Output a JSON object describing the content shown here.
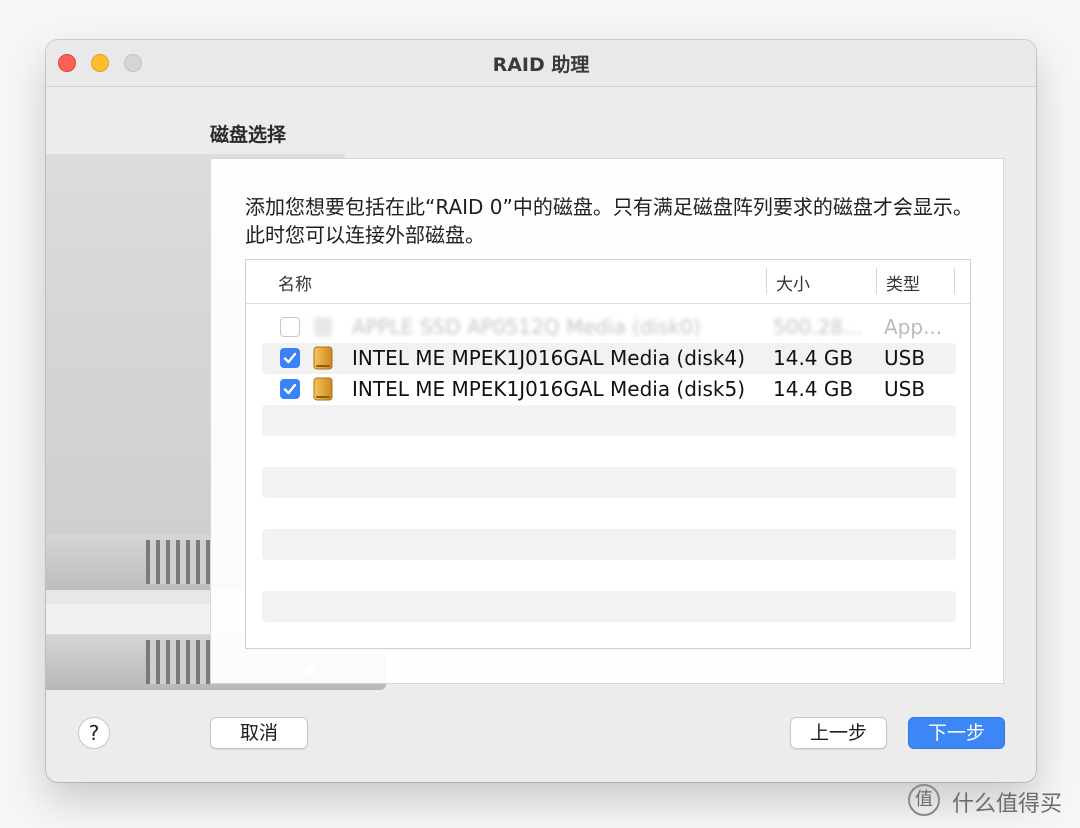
{
  "window": {
    "title": "RAID 助理"
  },
  "section": {
    "title": "磁盘选择"
  },
  "description": "添加您想要包括在此“RAID 0”中的磁盘。只有满足磁盘阵列要求的磁盘才会显示。此时您可以连接外部磁盘。",
  "table": {
    "headers": {
      "name": "名称",
      "size": "大小",
      "type": "类型"
    },
    "rows": [
      {
        "name": "APPLE SSD AP0512Q Media (disk0)",
        "size": "500.28...",
        "type": "App...",
        "checked": false,
        "disabled": true
      },
      {
        "name": "INTEL ME MPEK1J016GAL Media (disk4)",
        "size": "14.4 GB",
        "type": "USB",
        "checked": true,
        "disabled": false
      },
      {
        "name": "INTEL ME MPEK1J016GAL Media (disk5)",
        "size": "14.4 GB",
        "type": "USB",
        "checked": true,
        "disabled": false
      }
    ]
  },
  "buttons": {
    "help": "?",
    "cancel": "取消",
    "back": "上一步",
    "next": "下一步"
  },
  "icons": {
    "disk": "external-disk-icon",
    "check": "checkmark-icon"
  },
  "colors": {
    "accent": "#3d86f5",
    "disk": "#e3a63a"
  },
  "watermark": {
    "logo": "值",
    "text": "什么值得买"
  }
}
